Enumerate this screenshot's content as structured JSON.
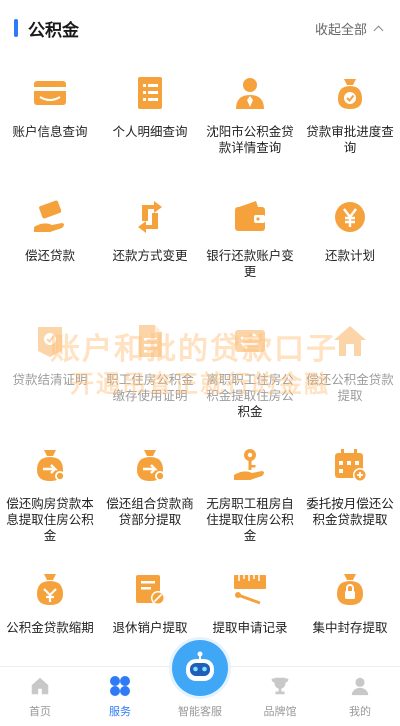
{
  "header": {
    "title": "公积金",
    "collapse_label": "收起全部"
  },
  "accent_color": "#2f7bf5",
  "icon_color": "#f5a23c",
  "services": [
    {
      "label": "账户信息查询",
      "icon": "card-icon"
    },
    {
      "label": "个人明细查询",
      "icon": "document-list-icon"
    },
    {
      "label": "沈阳市公积金贷款详情查询",
      "icon": "person-tie-icon"
    },
    {
      "label": "贷款审批进度查询",
      "icon": "money-bag-check-icon"
    },
    {
      "label": "偿还贷款",
      "icon": "hand-money-icon"
    },
    {
      "label": "还款方式变更",
      "icon": "exchange-arrows-icon"
    },
    {
      "label": "银行还款账户变更",
      "icon": "wallet-icon"
    },
    {
      "label": "还款计划",
      "icon": "yen-coin-icon"
    },
    {
      "label": "贷款结清证明",
      "icon": "certificate-icon"
    },
    {
      "label": "职工住房公积金缴存使用证明",
      "icon": "document-icon"
    },
    {
      "label": "离职职工住房公积金提取住房公积金",
      "icon": "transfer-icon"
    },
    {
      "label": "偿还公积金贷款提取",
      "icon": "house-icon"
    },
    {
      "label": "偿还购房贷款本息提取住房公积金",
      "icon": "money-bag-arrow-icon"
    },
    {
      "label": "偿还组合贷款商贷部分提取",
      "icon": "money-bag-arrow-icon"
    },
    {
      "label": "无房职工租房自住提取住房公积金",
      "icon": "key-hand-icon"
    },
    {
      "label": "委托按月偿还公积金贷款提取",
      "icon": "calendar-plus-icon"
    },
    {
      "label": "公积金贷款缩期",
      "icon": "money-bag-icon"
    },
    {
      "label": "退休销户提取",
      "icon": "ticket-cancel-icon"
    },
    {
      "label": "提取申请记录",
      "icon": "ruler-record-icon"
    },
    {
      "label": "集中封存提取",
      "icon": "lock-bag-icon"
    }
  ],
  "watermark": {
    "line1": "账户和批的贷款口子",
    "line2": "开通吊查正就行的金融"
  },
  "tabbar": {
    "items": [
      {
        "label": "首页",
        "icon": "home-icon"
      },
      {
        "label": "服务",
        "icon": "services-icon",
        "active": true
      },
      {
        "label": "智能客服",
        "icon": "robot-icon"
      },
      {
        "label": "品牌馆",
        "icon": "trophy-icon"
      },
      {
        "label": "我的",
        "icon": "user-icon"
      }
    ]
  }
}
